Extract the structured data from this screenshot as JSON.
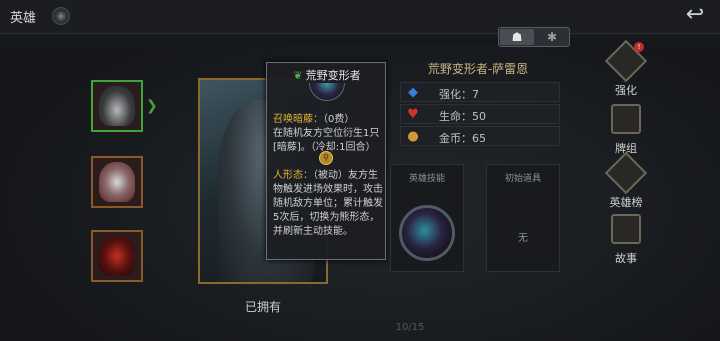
{
  "top": {
    "title": "英雄",
    "back_icon": "back-arrow-icon"
  },
  "toggle": {
    "left_icon": "skull-icon",
    "right_icon": "paw-icon"
  },
  "hero_list": [
    {
      "name": "hero-1",
      "selected": true
    },
    {
      "name": "hero-2",
      "selected": false
    },
    {
      "name": "hero-3",
      "selected": false
    }
  ],
  "portrait": {
    "owned_label": "已拥有",
    "page": "10/15"
  },
  "tooltip": {
    "title": "荒野变形者",
    "skill1_name": "召唤暗藤：",
    "skill1_cost": "（0费）",
    "skill1_desc": "在随机友方空位衍生1只[暗藤]。（冷却:1回合）",
    "skill2_name": "人形态：",
    "skill2_desc": "（被动）友方生物触发进场效果时，攻击随机敌方单位；累计触发5次后，切换为熊形态，并刷新主动技能。"
  },
  "hero": {
    "name": "荒野变形者-萨雷恩",
    "stats": [
      {
        "icon": "shield-icon",
        "label": "强化：",
        "value": "7",
        "color": "#3a7bd5"
      },
      {
        "icon": "heart-icon",
        "label": "生命：",
        "value": "50",
        "color": "#d0342c"
      },
      {
        "icon": "coin-icon",
        "label": "金币：",
        "value": "65",
        "color": "#d09a3a"
      }
    ]
  },
  "panels": {
    "skill_title": "英雄技能",
    "item_title": "初始道具",
    "item_none": "无"
  },
  "menu": [
    {
      "label": "强化",
      "badge": "!"
    },
    {
      "label": "牌组"
    },
    {
      "label": "英雄榜"
    },
    {
      "label": "故事"
    }
  ]
}
